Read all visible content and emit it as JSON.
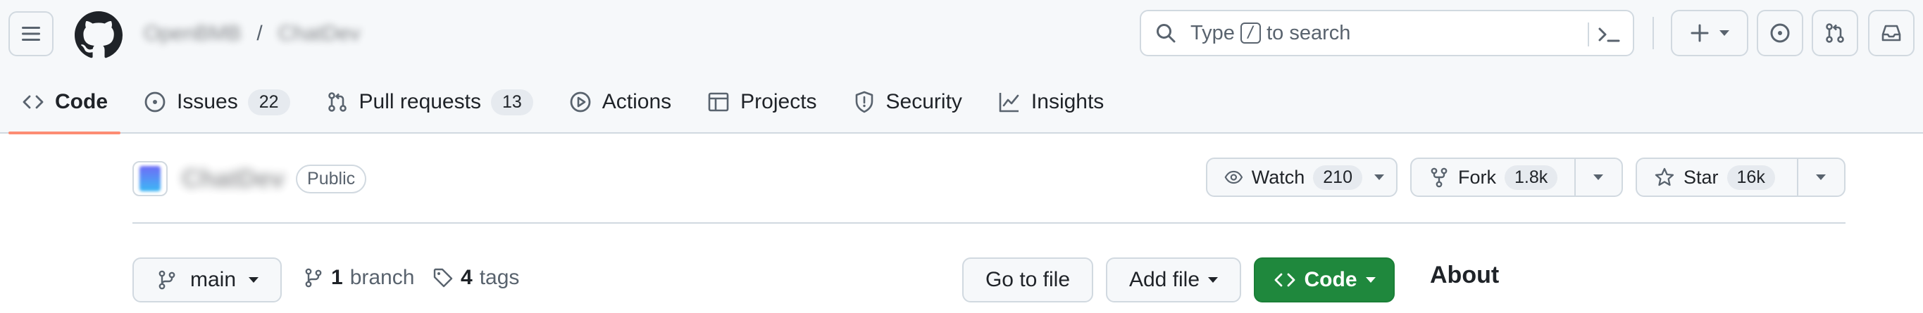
{
  "header": {
    "owner": "OpenBMB",
    "separator": "/",
    "repo": "ChatDev",
    "search": {
      "prefix": "Type",
      "key": "/",
      "suffix": "to search"
    }
  },
  "nav": {
    "tabs": [
      {
        "label": "Code",
        "icon": "code-icon",
        "selected": true
      },
      {
        "label": "Issues",
        "icon": "issue-opened-icon",
        "count": "22"
      },
      {
        "label": "Pull requests",
        "icon": "git-pull-request-icon",
        "count": "13"
      },
      {
        "label": "Actions",
        "icon": "play-icon"
      },
      {
        "label": "Projects",
        "icon": "table-icon"
      },
      {
        "label": "Security",
        "icon": "shield-icon"
      },
      {
        "label": "Insights",
        "icon": "graph-icon"
      }
    ]
  },
  "repo": {
    "name": "ChatDev",
    "visibility": "Public",
    "watch": {
      "label": "Watch",
      "count": "210"
    },
    "fork": {
      "label": "Fork",
      "count": "1.8k"
    },
    "star": {
      "label": "Star",
      "count": "16k"
    }
  },
  "toolbar": {
    "branch": "main",
    "branch_count": "1",
    "branch_label": "branch",
    "tag_count": "4",
    "tag_label": "tags",
    "goto_file": "Go to file",
    "add_file": "Add file",
    "code": "Code"
  },
  "sidebar": {
    "about_title": "About"
  },
  "colors": {
    "accent_underline": "#fd8c73",
    "code_button": "#1f883d",
    "border": "#d1d9e0",
    "header_bg": "#f6f8fa"
  }
}
